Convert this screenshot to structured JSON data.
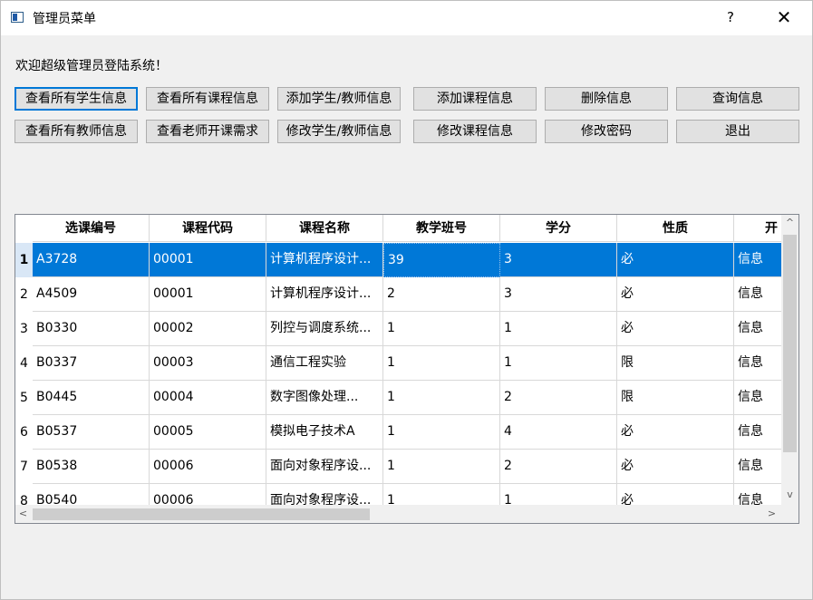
{
  "window": {
    "title": "管理员菜单",
    "help": "?",
    "close": "✕"
  },
  "welcome": "欢迎超级管理员登陆系统！",
  "buttons_row1": [
    "查看所有学生信息",
    "查看所有课程信息",
    "添加学生/教师信息",
    "添加课程信息",
    "删除信息",
    "查询信息"
  ],
  "buttons_row2": [
    "查看所有教师信息",
    "查看老师开课需求",
    "修改学生/教师信息",
    "修改课程信息",
    "修改密码",
    "退出"
  ],
  "table": {
    "headers": [
      "选课编号",
      "课程代码",
      "课程名称",
      "教学班号",
      "学分",
      "性质",
      "开"
    ],
    "rows": [
      {
        "num": "1",
        "cells": [
          "A3728",
          "00001",
          "计算机程序设计...",
          "39",
          "3",
          "必",
          "信息"
        ]
      },
      {
        "num": "2",
        "cells": [
          "A4509",
          "00001",
          "计算机程序设计...",
          "2",
          "3",
          "必",
          "信息"
        ]
      },
      {
        "num": "3",
        "cells": [
          "B0330",
          "00002",
          "列控与调度系统...",
          "1",
          "1",
          "必",
          "信息"
        ]
      },
      {
        "num": "4",
        "cells": [
          "B0337",
          "00003",
          "通信工程实验",
          "1",
          "1",
          "限",
          "信息"
        ]
      },
      {
        "num": "5",
        "cells": [
          "B0445",
          "00004",
          "数字图像处理...",
          "1",
          "2",
          "限",
          "信息"
        ]
      },
      {
        "num": "6",
        "cells": [
          "B0537",
          "00005",
          "模拟电子技术A",
          "1",
          "4",
          "必",
          "信息"
        ]
      },
      {
        "num": "7",
        "cells": [
          "B0538",
          "00006",
          "面向对象程序设...",
          "1",
          "2",
          "必",
          "信息"
        ]
      },
      {
        "num": "8",
        "cells": [
          "B0540",
          "00006",
          "面向对象程序设...",
          "1",
          "1",
          "必",
          "信息"
        ]
      }
    ],
    "selected_row": 0
  },
  "scroll": {
    "up": "^",
    "down": "v",
    "left": "<",
    "right": ">"
  },
  "colors": {
    "selection": "#0078d7",
    "focus_border": "#0078d7"
  }
}
